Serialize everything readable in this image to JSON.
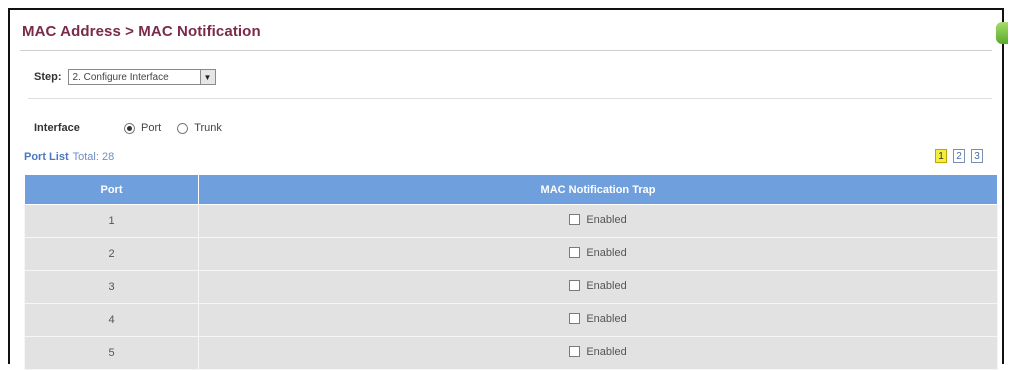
{
  "header": {
    "title": "MAC Address > MAC Notification"
  },
  "step": {
    "label": "Step:",
    "selected": "2. Configure Interface"
  },
  "interface": {
    "label": "Interface",
    "options": [
      {
        "label": "Port",
        "selected": true
      },
      {
        "label": "Trunk",
        "selected": false
      }
    ]
  },
  "port_list": {
    "label": "Port List",
    "total": "Total: 28"
  },
  "pagination": {
    "pages": [
      "1",
      "2",
      "3"
    ],
    "current": "1"
  },
  "table": {
    "columns": [
      "Port",
      "MAC Notification Trap"
    ],
    "rows": [
      {
        "port": "1",
        "trap_label": "Enabled",
        "checked": false
      },
      {
        "port": "2",
        "trap_label": "Enabled",
        "checked": false
      },
      {
        "port": "3",
        "trap_label": "Enabled",
        "checked": false
      },
      {
        "port": "4",
        "trap_label": "Enabled",
        "checked": false
      },
      {
        "port": "5",
        "trap_label": "Enabled",
        "checked": false
      }
    ]
  },
  "colors": {
    "title": "#7a2a4a",
    "table_header": "#6f9fdc",
    "row_bg": "#e2e2e2",
    "link": "#4a78c2",
    "active_page": "#f4ee3a"
  },
  "icons": {
    "help_corner": "help-tab-icon",
    "dropdown": "chevron-down-icon"
  }
}
